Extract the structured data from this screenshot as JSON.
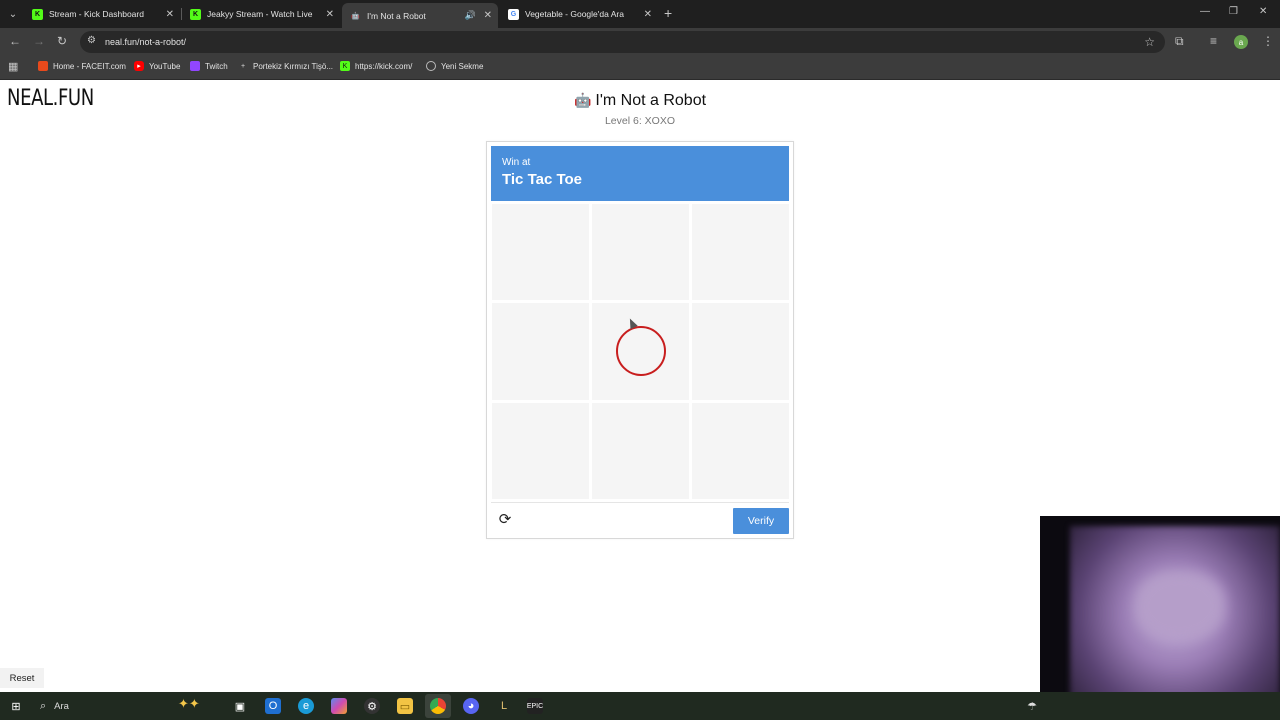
{
  "browser": {
    "tabs": [
      {
        "title": "Stream - Kick Dashboard",
        "icon": "kick-icon",
        "active": false
      },
      {
        "title": "Jeakyy Stream - Watch Live on Kick",
        "icon": "kick-icon",
        "active": false
      },
      {
        "title": "I'm Not a Robot",
        "icon": "robot-icon",
        "active": true
      },
      {
        "title": "Vegetable - Google'da Ara",
        "icon": "google-icon",
        "active": false
      }
    ],
    "url": "neal.fun/not-a-robot/",
    "bookmarks": [
      {
        "label": "Home - FACEIT.com",
        "icon": "faceit-icon"
      },
      {
        "label": "YouTube",
        "icon": "youtube-icon"
      },
      {
        "label": "Twitch",
        "icon": "twitch-icon"
      },
      {
        "label": "Portekiz Kırmızı Tişö...",
        "icon": "bookmark-icon"
      },
      {
        "label": "https://kick.com/",
        "icon": "kick-icon"
      },
      {
        "label": "Yeni Sekme",
        "icon": "globe-icon"
      }
    ],
    "profile_initial": "a"
  },
  "page": {
    "logo": "NEAL.FUN",
    "title": "I'm Not a Robot",
    "level": "Level 6: XOXO",
    "captcha": {
      "header_small": "Win at",
      "header_big": "Tic Tac Toe",
      "board": [
        "",
        "",
        "",
        "",
        "O",
        "",
        "",
        "",
        ""
      ],
      "verify_label": "Verify"
    },
    "reset_label": "Reset"
  },
  "taskbar": {
    "search_placeholder": "Ara"
  },
  "colors": {
    "accent": "#4a8fdb",
    "o_mark": "#c81e1e",
    "cell": "#f5f5f5"
  }
}
